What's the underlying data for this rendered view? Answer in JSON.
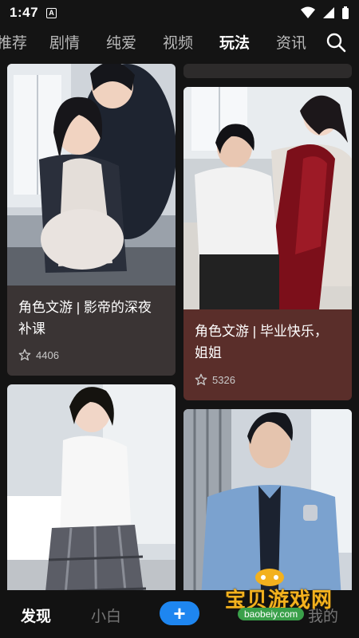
{
  "status_bar": {
    "time": "1:47",
    "badge": "A"
  },
  "tabs": [
    "推荐",
    "剧情",
    "纯爱",
    "视频",
    "玩法",
    "资讯"
  ],
  "cards": [
    {
      "title": "角色文游 | 影帝的深夜补课",
      "likes": "4406"
    },
    {
      "title": "角色文游 | 毕业快乐，姐姐",
      "likes": "5326"
    }
  ],
  "bottom_nav": {
    "discover": "发现",
    "novice": "小白",
    "plus": "+",
    "mine": "我的"
  },
  "watermark": {
    "text": "宝贝游戏网",
    "url": "baobeiy.com"
  },
  "colors": {
    "accent": "#1e86f0",
    "card_left": "#3a3434",
    "card_right": "#5a2e2a"
  }
}
